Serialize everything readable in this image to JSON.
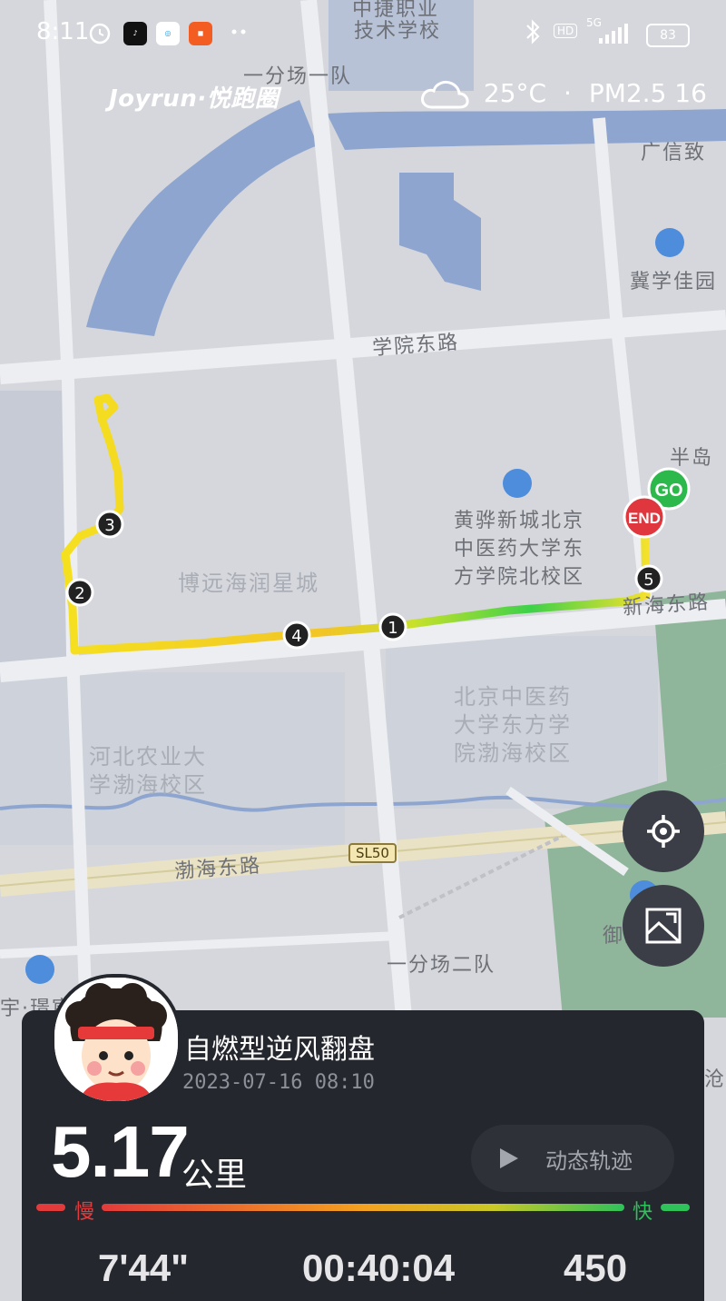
{
  "status_bar": {
    "time": "8:11",
    "network": "5G",
    "hd": "HD",
    "battery": "83"
  },
  "brand": {
    "name": "Joyrun·悦跑圈"
  },
  "weather": {
    "temp": "25°C",
    "separator": "·",
    "aqi": "PM2.5 16",
    "icon": "cloud-icon"
  },
  "map": {
    "labels": [
      "中捷职业",
      "技术学校",
      "一分场一队",
      "广信致",
      "冀学佳园",
      "学院东路",
      "半岛",
      "黄骅新城北京中医药大学东方学院北校区",
      "博远海润星城",
      "新海东路",
      "北京中医药大学东方学院渤海校区",
      "河北农业大学渤海校区",
      "渤海东路",
      "SL50",
      "一分场二队",
      "御湖",
      "宇·璟宸",
      "沧"
    ],
    "markers": {
      "start": "GO",
      "end": "END",
      "km": [
        "1",
        "2",
        "3",
        "4",
        "5"
      ]
    }
  },
  "card": {
    "username": "自燃型逆风翻盘",
    "datetime": "2023-07-16 08:10",
    "distance": "5.17",
    "distance_unit": "公里",
    "replay_label": "动态轨迹",
    "pace_slow": "慢",
    "pace_fast": "快",
    "stats": [
      "7'44\"",
      "00:40:04",
      "450"
    ]
  },
  "colors": {
    "slow": "#e23b3b",
    "mid": "#f5d020",
    "fast": "#2fc15a",
    "card_bg": "#25272e"
  }
}
